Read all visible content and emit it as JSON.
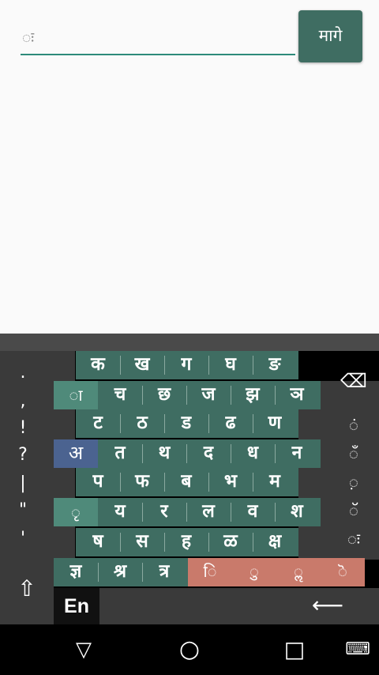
{
  "input": {
    "value": "ः"
  },
  "back_button": {
    "label": "मागे"
  },
  "left_keys": [
    ".",
    ",",
    "!",
    "?",
    "|",
    "\"",
    "'"
  ],
  "right_keys": {
    "backspace": "⌫",
    "k1": "ं",
    "k2": "ँ",
    "k3": "़",
    "k4": "ॅ",
    "k5": "ः"
  },
  "rows": [
    {
      "keys": [
        "क",
        "ख",
        "ग",
        "घ",
        "ङ"
      ]
    },
    {
      "special": "ा",
      "keys": [
        "च",
        "छ",
        "ज",
        "झ",
        "ञ"
      ]
    },
    {
      "keys": [
        "ट",
        "ठ",
        "ड",
        "ढ",
        "ण"
      ]
    },
    {
      "special": "अ",
      "keys": [
        "त",
        "थ",
        "द",
        "ध",
        "न"
      ]
    },
    {
      "keys": [
        "प",
        "फ",
        "ब",
        "भ",
        "म"
      ]
    },
    {
      "special": "ृ",
      "keys": [
        "य",
        "र",
        "ल",
        "व",
        "श"
      ]
    },
    {
      "keys": [
        "ष",
        "स",
        "ह",
        "ळ",
        "क्ष"
      ]
    },
    {
      "keys": [
        "ज्ञ",
        "श्र",
        "त्र"
      ]
    }
  ],
  "salmon_keys": [
    "ि",
    "ु",
    "ॢ",
    "ॆ"
  ],
  "bottom": {
    "shift": "⇧",
    "lang": "En",
    "enter": "⟵"
  },
  "nav": {
    "back": "▽",
    "home": "○",
    "recents": "□",
    "keyboard": "⌨"
  }
}
